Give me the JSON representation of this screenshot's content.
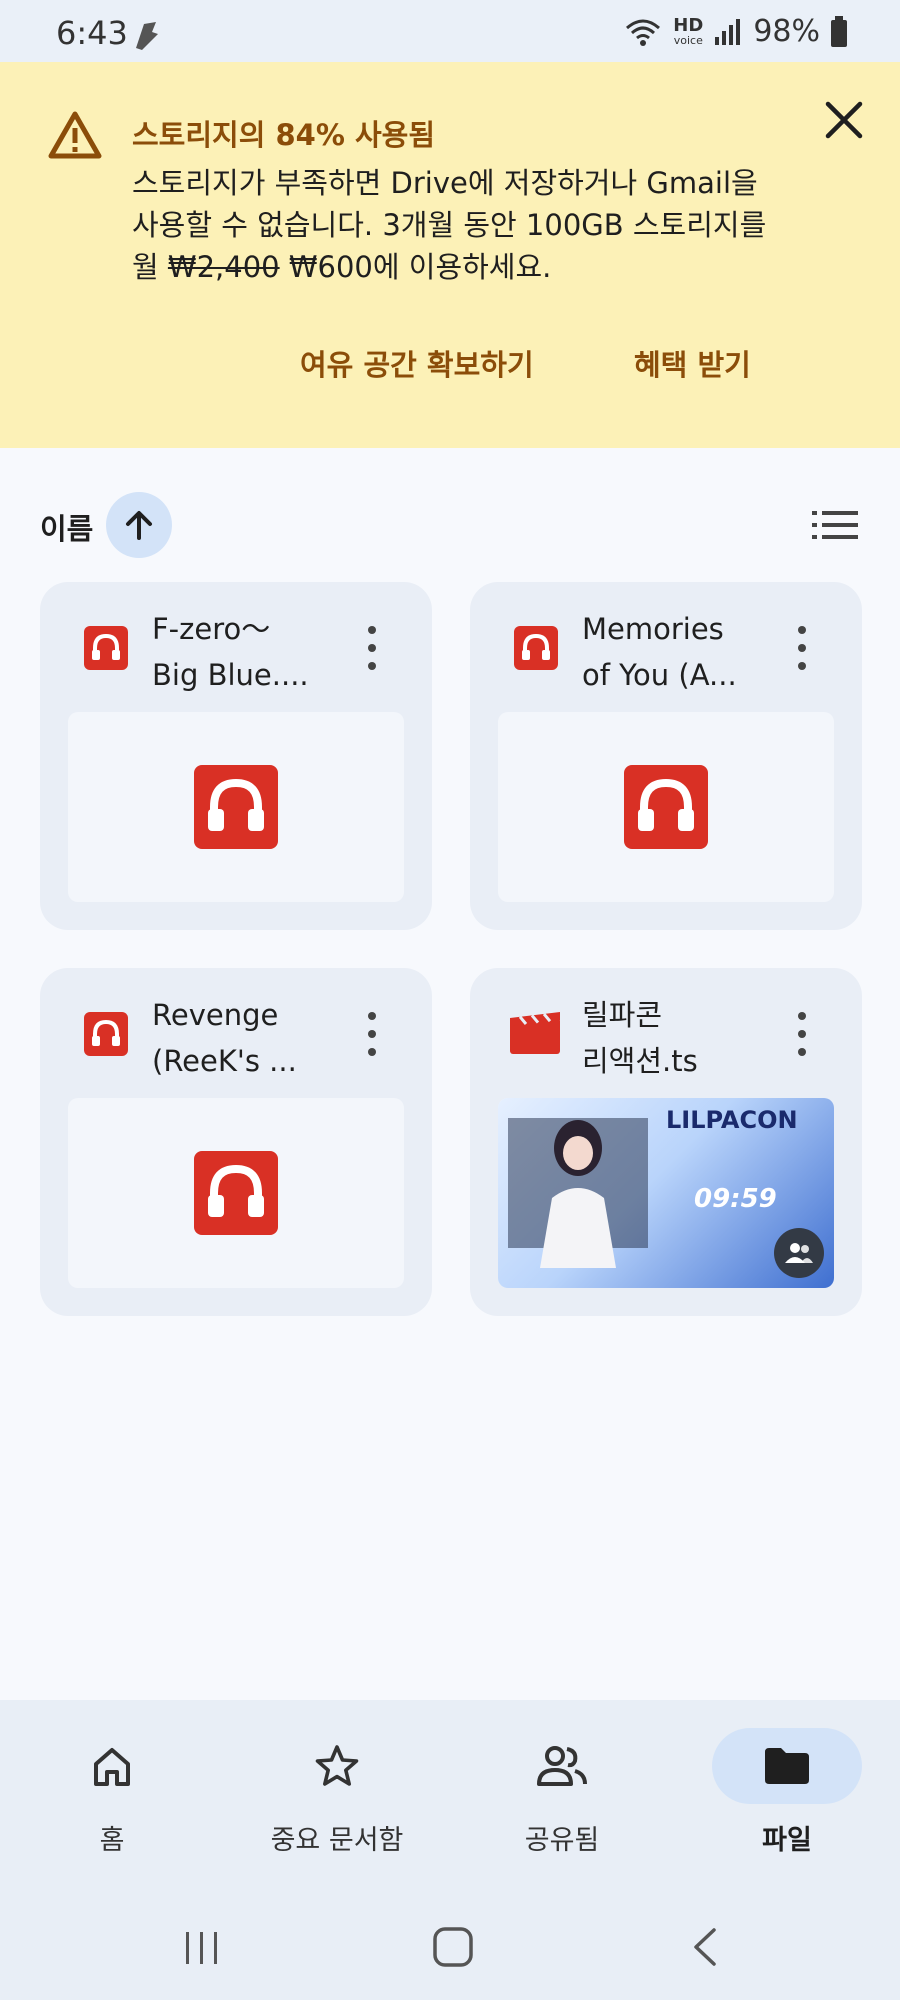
{
  "status_bar": {
    "time": "6:43",
    "network": "HD",
    "network_sub": "voice",
    "battery": "98%"
  },
  "banner": {
    "title": "스토리지의 84% 사용됨",
    "body_before_old_price": "스토리지가 부족하면 Drive에 저장하거나 Gmail을 사용할 수 없습니다. 3개월 동안 100GB 스토리지를 월 ",
    "old_price": "₩2,400",
    "new_price": " ₩600",
    "body_after_price": "에 이용하세요.",
    "action_free_space": "여유 공간 확보하기",
    "action_get_offer": "혜택 받기",
    "accent_color": "#8b4d09",
    "background_color": "#fcf1b7"
  },
  "sort": {
    "label": "이름",
    "direction": "ascending"
  },
  "files": [
    {
      "title": "F-zero～\nBig Blue....",
      "type": "audio"
    },
    {
      "title": "Memories\nof You (A...",
      "type": "audio"
    },
    {
      "title": "Revenge\n(ReeK's ...",
      "type": "audio"
    },
    {
      "title": "릴파콘\n리액션.ts",
      "type": "video",
      "thumbnail_text": "LILPACON",
      "thumbnail_time": "09:59"
    }
  ],
  "bottom_nav": {
    "items": [
      {
        "label": "홈",
        "icon": "home-icon"
      },
      {
        "label": "중요 문서함",
        "icon": "star-icon"
      },
      {
        "label": "공유됨",
        "icon": "people-icon"
      },
      {
        "label": "파일",
        "icon": "folder-icon",
        "active": true
      }
    ],
    "active_color": "#d3e3f8"
  },
  "colors": {
    "audio_icon": "#d93025",
    "video_icon": "#d93025"
  }
}
